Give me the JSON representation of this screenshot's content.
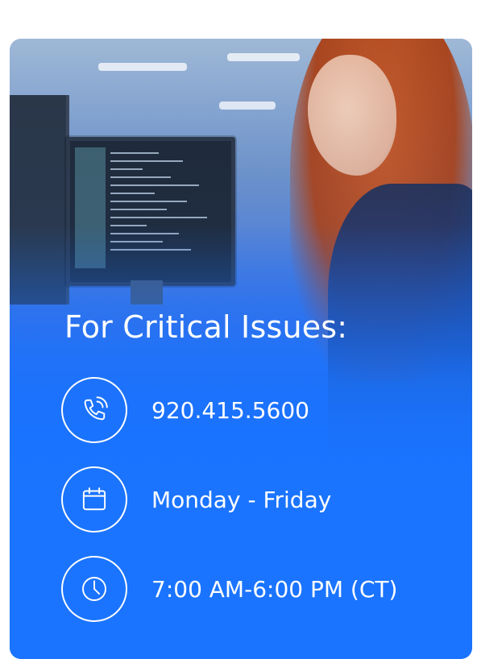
{
  "hero": {
    "image_alt_icon": "person-at-computer-photo",
    "accent_color": "#1a74ff"
  },
  "support": {
    "title": "For Critical Issues:",
    "items": [
      {
        "icon": "phone-icon",
        "text": "920.415.5600"
      },
      {
        "icon": "calendar-icon",
        "text": "Monday - Friday"
      },
      {
        "icon": "clock-icon",
        "text": "7:00 AM-6:00 PM (CT)"
      }
    ]
  }
}
